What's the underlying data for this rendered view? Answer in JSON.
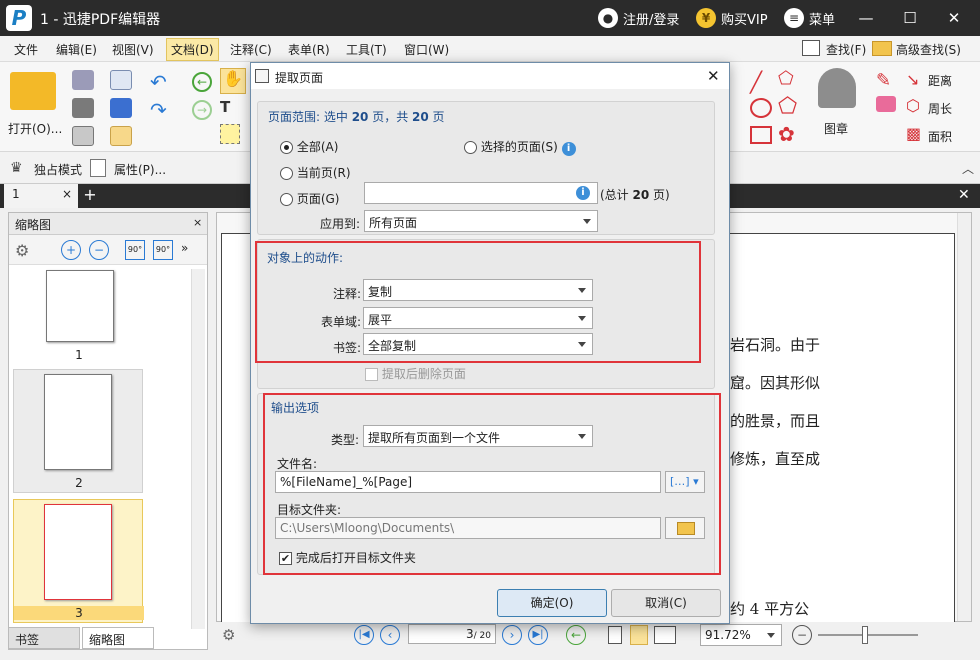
{
  "window": {
    "title": "1 - 迅捷PDF编辑器",
    "register": "注册/登录",
    "vip": "购买VIP",
    "menu": "菜单"
  },
  "menubar": [
    "文件",
    "编辑(E)",
    "视图(V)",
    "文档(D)",
    "注释(C)",
    "表单(R)",
    "工具(T)",
    "窗口(W)"
  ],
  "menubar_right": {
    "find": "查找(F)",
    "advanced_find": "高级查找(S)"
  },
  "ribbon": {
    "open_label": "打开(O)...",
    "stamp": "图章",
    "distance": "距离",
    "perimeter": "周长",
    "area": "面积"
  },
  "ribbon2": {
    "exclusive_mode": "独占模式",
    "properties": "属性(P)..."
  },
  "doc_tab": {
    "label": "1",
    "close": "×",
    "add": "+"
  },
  "left_panel": {
    "title": "缩略图",
    "thumbs": [
      "1",
      "2",
      "3"
    ]
  },
  "bottom_tabs": [
    "书签",
    "缩略图"
  ],
  "document_text": [
    "岩石洞。由于",
    "窟。因其形似",
    "的胜景，而且",
    "修炼，直至成",
    "约 4 平方公"
  ],
  "statusbar": {
    "page_current": "3",
    "page_total": "/ 20",
    "zoom": "91.72%"
  },
  "dialog": {
    "title": "提取页面",
    "range_header_prefix": "页面范围: 选中 ",
    "range_selected": "20",
    "range_header_mid": " 页，共 ",
    "range_total": "20",
    "range_header_suffix": " 页",
    "radio_all": "全部(A)",
    "radio_selected": "选择的页面(S)",
    "radio_current": "当前页(R)",
    "radio_pages": "页面(G)",
    "pages_input_value": "",
    "total_prefix": "(总计 ",
    "total_pages": "20",
    "total_suffix": " 页)",
    "apply_to_label": "应用到:",
    "apply_to_value": "所有页面",
    "actions_header": "对象上的动作:",
    "annot_label": "注释:",
    "annot_value": "复制",
    "form_label": "表单域:",
    "form_value": "展平",
    "bookmark_label": "书签:",
    "bookmark_value": "全部复制",
    "delete_after": "提取后删除页面",
    "output_header": "输出选项",
    "type_label": "类型:",
    "type_value": "提取所有页面到一个文件",
    "filename_label": "文件名:",
    "filename_value": "%[FileName]_%[Page]",
    "folder_label": "目标文件夹:",
    "folder_value": "C:\\Users\\Mloong\\Documents\\",
    "open_folder_label": "完成后打开目标文件夹",
    "ok": "确定(O)",
    "cancel": "取消(C)"
  },
  "colors": {
    "titlebar": "#2b2b2b",
    "accent": "#1b7fc4",
    "highlight": "#e0343a"
  }
}
